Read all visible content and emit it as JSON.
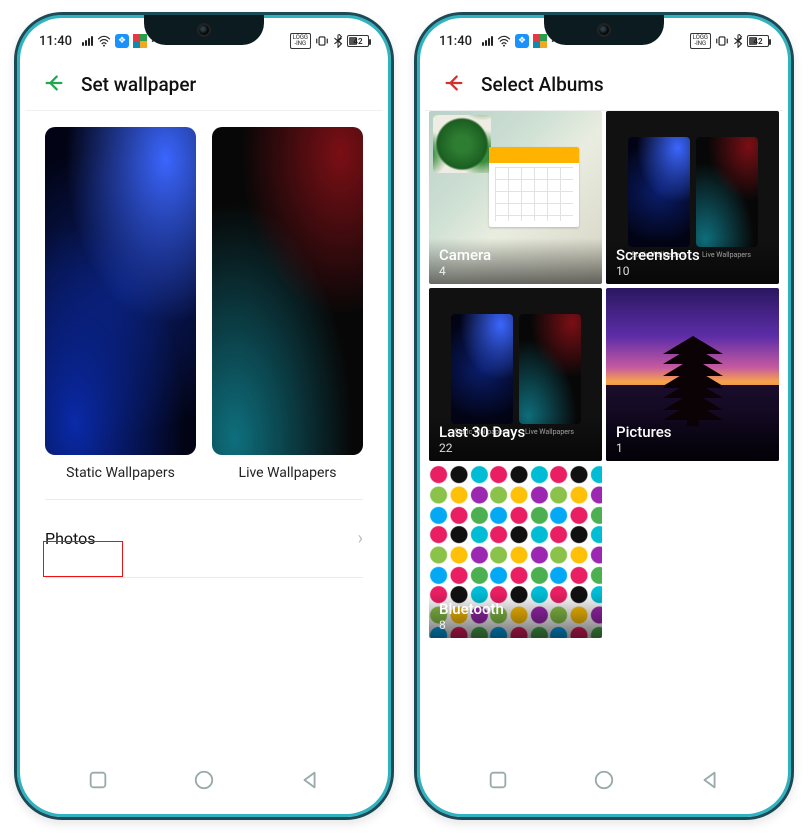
{
  "status": {
    "time": "11:40",
    "logg": "LOGG\n-ING",
    "battery_pct": 42
  },
  "left": {
    "title": "Set wallpaper",
    "static_label": "Static Wallpapers",
    "live_label": "Live Wallpapers",
    "photos_label": "Photos"
  },
  "right": {
    "title": "Select Albums",
    "mini_static": "Static Wallpapers",
    "mini_live": "Live Wallpapers",
    "albums": [
      {
        "name": "Camera",
        "count": "4"
      },
      {
        "name": "Screenshots",
        "count": "10"
      },
      {
        "name": "Last 30 Days",
        "count": "22"
      },
      {
        "name": "Pictures",
        "count": "1"
      },
      {
        "name": "Bluetooth",
        "count": "8"
      }
    ]
  }
}
